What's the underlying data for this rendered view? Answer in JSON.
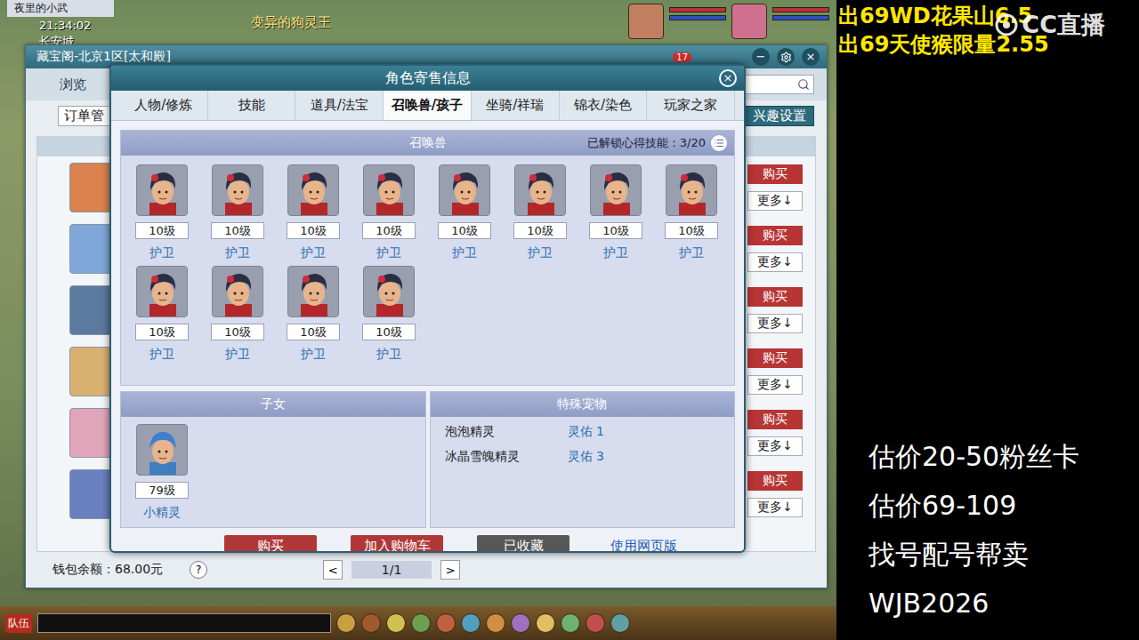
{
  "game": {
    "player_name": "夜里的小武",
    "time": "21:34:02",
    "location": "长安城",
    "npc_label": "变异的狗灵王",
    "team_label": "队伍"
  },
  "cbg_window": {
    "title": "藏宝阁-北京1区[太和殿]",
    "mail_badge": "17",
    "minimize": "−",
    "close": "×",
    "nav": [
      {
        "label": "浏览",
        "selected": true
      }
    ],
    "order_button": "订单管",
    "interest_button": "兴趣设置",
    "rows": [
      {
        "buy": "购买",
        "more": "更多↓"
      },
      {
        "buy": "购买",
        "more": "更多↓"
      },
      {
        "buy": "购买",
        "more": "更多↓"
      },
      {
        "buy": "购买",
        "more": "更多↓"
      },
      {
        "buy": "购买",
        "more": "更多↓"
      },
      {
        "buy": "购买",
        "more": "更多↓"
      }
    ],
    "wallet": "钱包余额：68.00元",
    "help": "?",
    "prev": "<",
    "page": "1/1",
    "next": ">"
  },
  "dialog": {
    "title": "角色寄售信息",
    "close": "×",
    "tabs": [
      {
        "label": "人物/修炼",
        "selected": false
      },
      {
        "label": "技能",
        "selected": false
      },
      {
        "label": "道具/法宝",
        "selected": false
      },
      {
        "label": "召唤兽/孩子",
        "selected": true
      },
      {
        "label": "坐骑/祥瑞",
        "selected": false
      },
      {
        "label": "锦衣/染色",
        "selected": false
      },
      {
        "label": "玩家之家",
        "selected": false
      }
    ],
    "pets_section": {
      "title": "召唤兽",
      "unlocked": "已解锁心得技能：3/20",
      "pets": [
        {
          "level": "10级",
          "name": "护卫"
        },
        {
          "level": "10级",
          "name": "护卫"
        },
        {
          "level": "10级",
          "name": "护卫"
        },
        {
          "level": "10级",
          "name": "护卫"
        },
        {
          "level": "10级",
          "name": "护卫"
        },
        {
          "level": "10级",
          "name": "护卫"
        },
        {
          "level": "10级",
          "name": "护卫"
        },
        {
          "level": "10级",
          "name": "护卫"
        },
        {
          "level": "10级",
          "name": "护卫"
        },
        {
          "level": "10级",
          "name": "护卫"
        },
        {
          "level": "10级",
          "name": "护卫"
        },
        {
          "level": "10级",
          "name": "护卫"
        }
      ]
    },
    "children": {
      "title": "子女",
      "items": [
        {
          "level": "79级",
          "name": "小精灵"
        }
      ]
    },
    "special": {
      "title": "特殊宠物",
      "items": [
        {
          "name": "泡泡精灵",
          "value": "灵佑 1"
        },
        {
          "name": "冰晶雪魄精灵",
          "value": "灵佑 3"
        }
      ]
    },
    "buttons": [
      {
        "label": "购买",
        "kind": "primary"
      },
      {
        "label": "加入购物车",
        "kind": "primary"
      },
      {
        "label": "已收藏",
        "kind": "muted"
      },
      {
        "label": "使用网页版",
        "kind": "link"
      }
    ]
  },
  "overlay": {
    "sale_lines": [
      "出69WD花果山6.5",
      "出69天使猴限量2.55"
    ],
    "watermark": "CC直播",
    "info_lines": [
      "估价20-50粉丝卡",
      "估价69-109",
      "找号配号帮卖",
      "WJB2026"
    ]
  }
}
